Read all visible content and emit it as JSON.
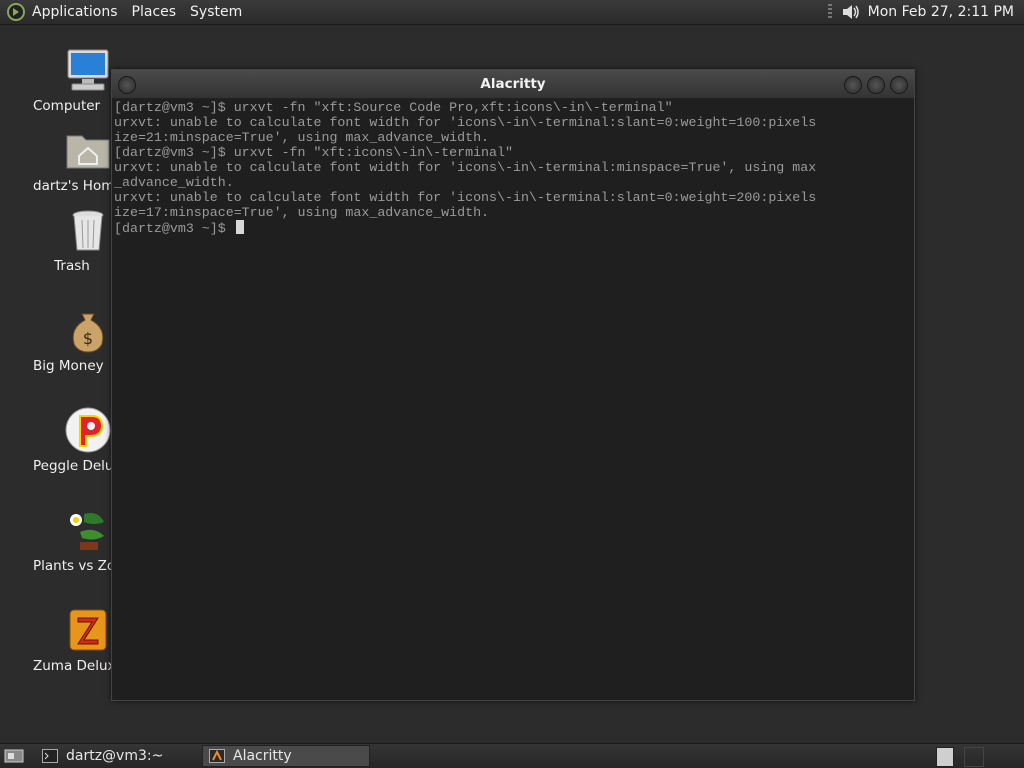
{
  "top_panel": {
    "menus": [
      "Applications",
      "Places",
      "System"
    ],
    "clock": "Mon Feb 27,  2:11 PM"
  },
  "desktop_icons": [
    {
      "label": "Computer",
      "icon": "computer-icon"
    },
    {
      "label": "dartz's Home",
      "icon": "home-folder-icon"
    },
    {
      "label": "Trash",
      "icon": "trash-icon"
    },
    {
      "label": "Big Money Deluxe",
      "icon": "money-bag-icon"
    },
    {
      "label": "Peggle Deluxe",
      "icon": "peggle-icon"
    },
    {
      "label": "Plants vs Zombies",
      "icon": "plants-icon"
    },
    {
      "label": "Zuma Deluxe",
      "icon": "zuma-icon"
    }
  ],
  "window": {
    "title": "Alacritty",
    "terminal_lines": [
      "[dartz@vm3 ~]$ urxvt -fn \"xft:Source Code Pro,xft:icons\\-in\\-terminal\"",
      "urxvt: unable to calculate font width for 'icons\\-in\\-terminal:slant=0:weight=100:pixels",
      "ize=21:minspace=True', using max_advance_width.",
      "[dartz@vm3 ~]$ urxvt -fn \"xft:icons\\-in\\-terminal\"",
      "urxvt: unable to calculate font width for 'icons\\-in\\-terminal:minspace=True', using max",
      "_advance_width.",
      "urxvt: unable to calculate font width for 'icons\\-in\\-terminal:slant=0:weight=200:pixels",
      "ize=17:minspace=True', using max_advance_width."
    ],
    "prompt": "[dartz@vm3 ~]$ "
  },
  "taskbar": {
    "tasks": [
      {
        "label": "dartz@vm3:~",
        "icon": "terminal-icon",
        "active": false
      },
      {
        "label": "Alacritty",
        "icon": "alacritty-icon",
        "active": true
      }
    ]
  }
}
